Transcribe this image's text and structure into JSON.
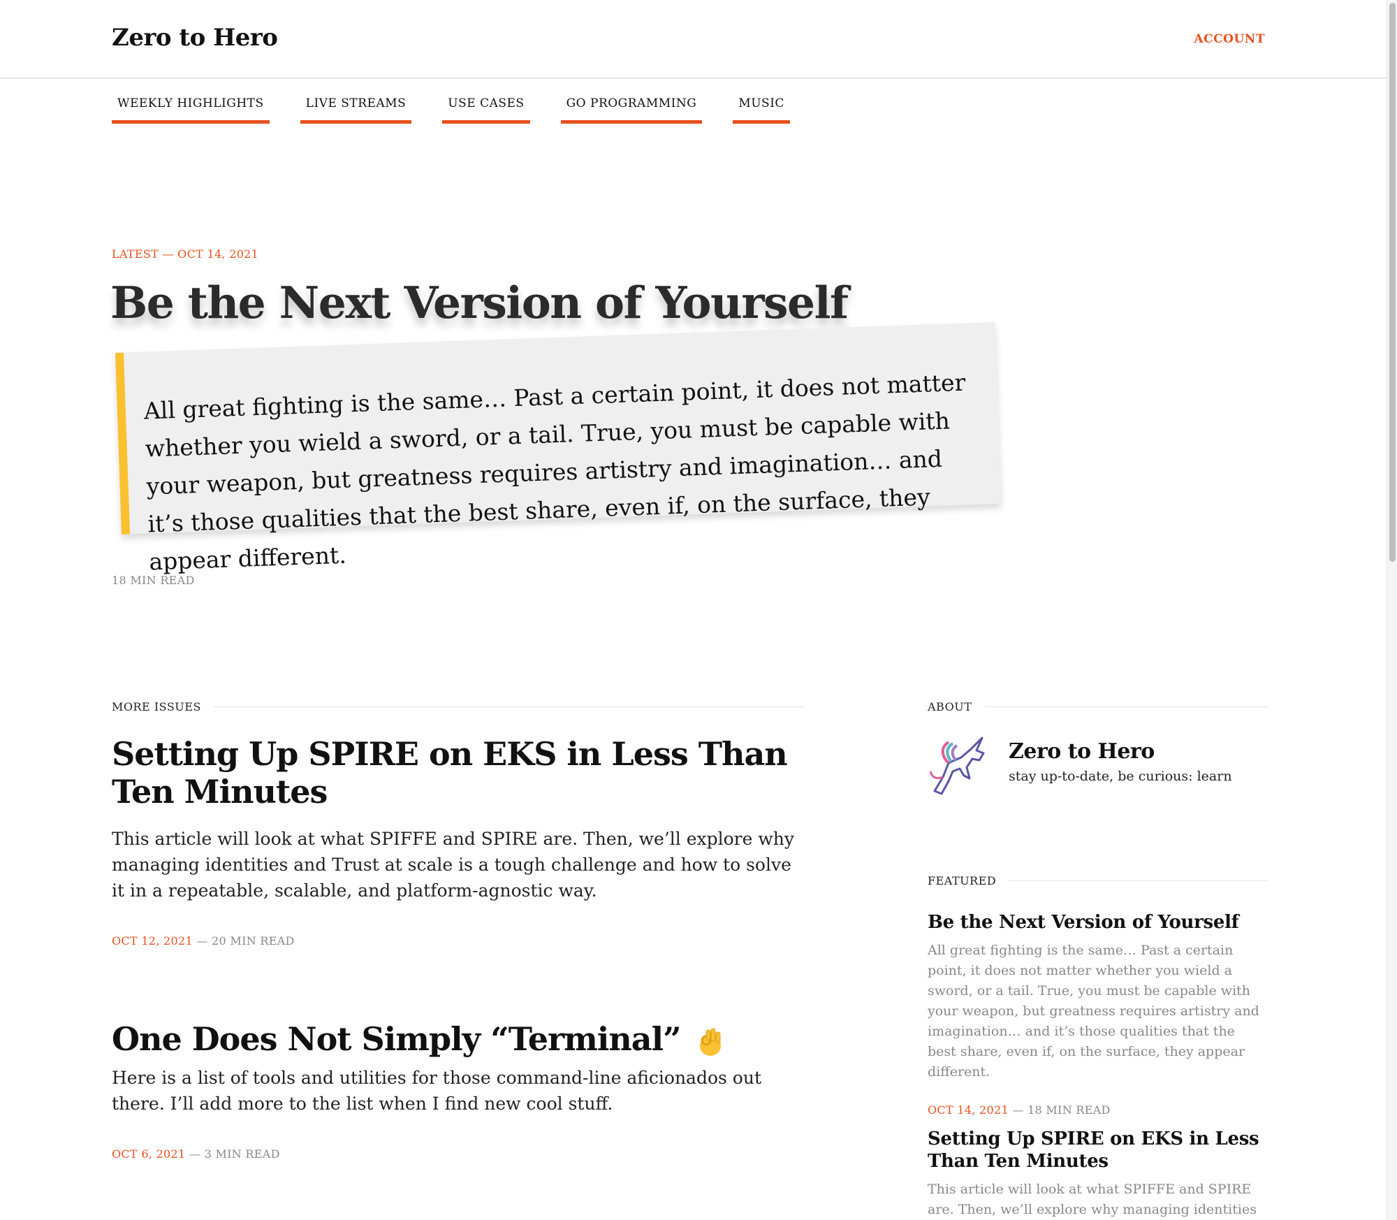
{
  "header": {
    "site_title": "Zero to Hero",
    "account_label": "ACCOUNT"
  },
  "nav": {
    "items": [
      {
        "label": "WEEKLY HIGHLIGHTS"
      },
      {
        "label": "LIVE STREAMS"
      },
      {
        "label": "USE CASES"
      },
      {
        "label": "GO PROGRAMMING"
      },
      {
        "label": "MUSIC"
      }
    ]
  },
  "hero": {
    "latest_label": "LATEST — OCT 14, 2021",
    "title": "Be the Next Version of Yourself",
    "quote": "All great fighting is the same… Past a certain point, it does not matter whether you wield a sword, or a tail. True, you must be capable with your weapon, but greatness requires artistry and imagination… and it’s those qualities that the best share, even if, on the surface, they appear different.",
    "read_time": "18 MIN READ"
  },
  "more_issues": {
    "heading": "MORE ISSUES",
    "articles": [
      {
        "title": "Setting Up SPIRE on EKS in Less Than Ten Minutes",
        "excerpt": "This article will look at what SPIFFE and SPIRE are. Then, we’ll explore why managing identities and Trust at scale is a tough challenge and how to solve it in a repeatable, scalable, and platform-agnostic way.",
        "date": "OCT 12, 2021",
        "read_time": "— 20 MIN READ"
      },
      {
        "title": "One Does Not Simply “Terminal”",
        "emoji_icon": "ok-hand-emoji-icon",
        "excerpt": "Here is a list of tools and utilities for those command-line aficionados out there. I’ll add more to the list when I find new cool stuff.",
        "date": "OCT 6, 2021",
        "read_time": "— 3 MIN READ"
      }
    ]
  },
  "about": {
    "heading": "ABOUT",
    "icon": "unicorn-icon",
    "name": "Zero to Hero",
    "tagline": "stay up-to-date, be curious: learn"
  },
  "featured": {
    "heading": "FEATURED",
    "items": [
      {
        "title": "Be the Next Version of Yourself",
        "excerpt": "All great fighting is the same… Past a certain point, it does not matter whether you wield a sword, or a tail. True, you must be capable with your weapon, but greatness requires artistry and imagination… and it’s those qualities that the best share, even if, on the surface, they appear different.",
        "date": "OCT 14, 2021",
        "read_time": "— 18 MIN READ"
      },
      {
        "title": "Setting Up SPIRE on EKS in Less Than Ten Minutes",
        "excerpt": "This article will look at what SPIFFE and SPIRE are. Then, we’ll explore why managing identities and"
      }
    ]
  },
  "colors": {
    "accent": "#e8501e",
    "quote_bar": "#fbc02d",
    "quote_bg": "#efefef"
  }
}
